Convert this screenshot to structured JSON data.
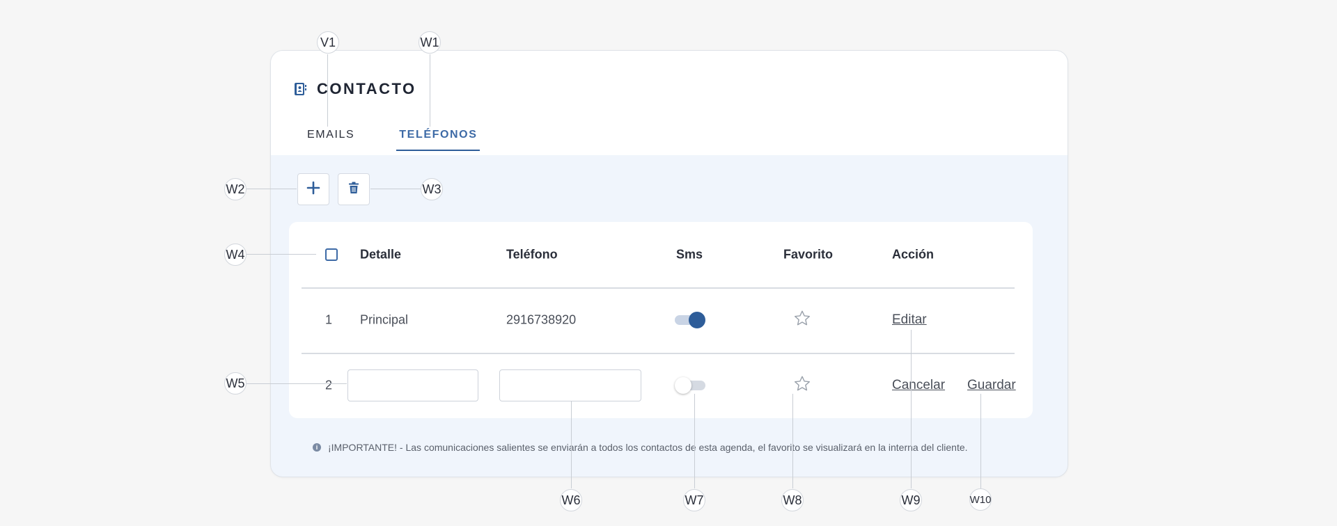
{
  "card": {
    "title": "CONTACTO",
    "title_icon": "address-book-icon",
    "tabs": [
      {
        "label": "EMAILS",
        "active": false
      },
      {
        "label": "TELÉFONOS",
        "active": true
      }
    ]
  },
  "toolbar": {
    "add_icon": "plus-icon",
    "delete_icon": "trash-icon"
  },
  "table": {
    "columns": [
      "Detalle",
      "Teléfono",
      "Sms",
      "Favorito",
      "Acción"
    ],
    "rows": [
      {
        "index": "1",
        "detalle": "Principal",
        "telefono": "2916738920",
        "sms": true,
        "favorito": false,
        "action": "Editar"
      },
      {
        "index": "2",
        "detalle": "",
        "telefono": "",
        "sms": false,
        "favorito": false,
        "cancel": "Cancelar",
        "save": "Guardar"
      }
    ]
  },
  "notice": "¡IMPORTANTE! - Las comunicaciones salientes se enviarán a todos los contactos de esta agenda, el favorito se visualizará en la interna del cliente.",
  "annotations": [
    "V1",
    "W1",
    "W2",
    "W3",
    "W4",
    "W5",
    "W6",
    "W7",
    "W8",
    "W9",
    "W10"
  ],
  "colors": {
    "accent": "#2e5d99",
    "link": "#3d6aa6",
    "panel_bg": "#f0f5fc",
    "page_bg": "#f6f6f6"
  }
}
